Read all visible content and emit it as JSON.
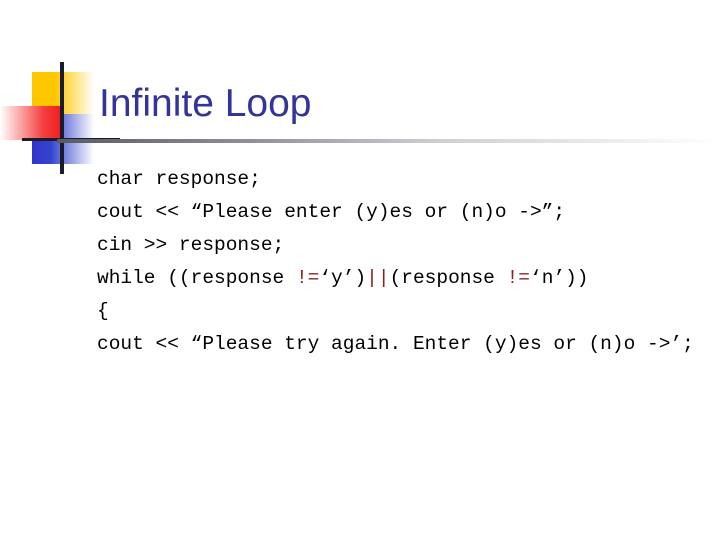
{
  "slide": {
    "title": "Infinite Loop",
    "title_color": "#333399",
    "background_color": "#ffffff",
    "operator_color": "#8B2020",
    "text_color": "#000000"
  },
  "logo": {
    "name": "decorative-squares-logo",
    "yellow_color": "#FFC700",
    "blue_color": "#3333CC",
    "red_color": "#F02020",
    "line_color": "#1b1b2e"
  },
  "code": {
    "lines": [
      {
        "id": "line-1",
        "segments": [
          {
            "text": "char response;",
            "kind": "plain"
          }
        ]
      },
      {
        "id": "line-2",
        "segments": [
          {
            "text": "cout << “Please enter (y)es or (n)o ->”;",
            "kind": "plain"
          }
        ]
      },
      {
        "id": "line-3",
        "segments": [
          {
            "text": "cin >> response;",
            "kind": "plain"
          }
        ]
      },
      {
        "id": "line-4",
        "wrap": true,
        "segments": [
          {
            "text": "while ((response ",
            "kind": "plain"
          },
          {
            "text": "!=",
            "kind": "op"
          },
          {
            "text": "‘y’)",
            "kind": "plain"
          },
          {
            "text": "||",
            "kind": "op"
          },
          {
            "text": "(response ",
            "kind": "plain"
          },
          {
            "text": "!=",
            "kind": "op"
          },
          {
            "text": "‘n’))",
            "kind": "plain"
          }
        ]
      },
      {
        "id": "line-5",
        "segments": [
          {
            "text": "{",
            "kind": "plain"
          }
        ]
      },
      {
        "id": "line-6",
        "wrap": true,
        "segments": [
          {
            "text": "cout << “Please try again. Enter (y)es or (n)o ->’;",
            "kind": "plain"
          }
        ]
      }
    ]
  }
}
